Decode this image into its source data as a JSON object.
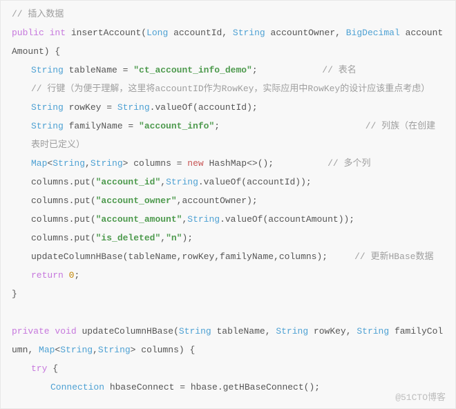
{
  "code": {
    "c1": "// 插入数据",
    "sig1a": "public",
    "sig1b": "int",
    "sig1c": " insertAccount(",
    "sig1d": "Long",
    "sig1e": " accountId, ",
    "sig1f": "String",
    "sig1g": " accountOwner, ",
    "sig1h": "BigDecimal",
    "sig1i": " accountAmount) {",
    "l3a": "String",
    "l3b": " tableName = ",
    "l3c": "\"ct_account_info_demo\"",
    "l3d": ";            ",
    "l3e": "// 表名",
    "l4": "// 行键（为便于理解，这里将accountID作为RowKey，实际应用中RowKey的设计应该重点考虑）",
    "l5a": "String",
    "l5b": " rowKey = ",
    "l5c": "String",
    "l5d": ".valueOf(accountId);",
    "l6a": "String",
    "l6b": " familyName = ",
    "l6c": "\"account_info\"",
    "l6d": ";                           ",
    "l6e": "// 列族（在创建表时已定义）",
    "l7a": "Map",
    "l7b": "<",
    "l7c": "String",
    "l7d": ",",
    "l7e": "String",
    "l7f": "> columns = ",
    "l7g": "new",
    "l7h": " HashMap<>();          ",
    "l7i": "// 多个列",
    "l8a": "columns.put(",
    "l8b": "\"account_id\"",
    "l8c": ",",
    "l8d": "String",
    "l8e": ".valueOf(accountId));",
    "l9a": "columns.put(",
    "l9b": "\"account_owner\"",
    "l9c": ",accountOwner);",
    "l10a": "columns.put(",
    "l10b": "\"account_amount\"",
    "l10c": ",",
    "l10d": "String",
    "l10e": ".valueOf(accountAmount));",
    "l11a": "columns.put(",
    "l11b": "\"is_deleted\"",
    "l11c": ",",
    "l11d": "\"n\"",
    "l11e": ");",
    "l12a": "updateColumnHBase(tableName,rowKey,familyName,columns);     ",
    "l12b": "// 更新HBase数据",
    "l13a": "return",
    "l13b": " ",
    "l13c": "0",
    "l13d": ";",
    "l14": "}",
    "blank": " ",
    "sig2a": "private",
    "sig2b": " ",
    "sig2c": "void",
    "sig2d": " updateColumnHBase(",
    "sig2e": "String",
    "sig2f": " tableName, ",
    "sig2g": "String",
    "sig2h": " rowKey, ",
    "sig2i": "String",
    "sig2j": " familyColumn, ",
    "sig2k": "Map",
    "sig2l": "<",
    "sig2m": "String",
    "sig2n": ",",
    "sig2o": "String",
    "sig2p": "> columns) {",
    "l17a": "try",
    "l17b": " {",
    "l18a": "Connection",
    "l18b": " hbaseConnect = hbase.getHBaseConnect();"
  },
  "watermark": "@51CTO博客"
}
